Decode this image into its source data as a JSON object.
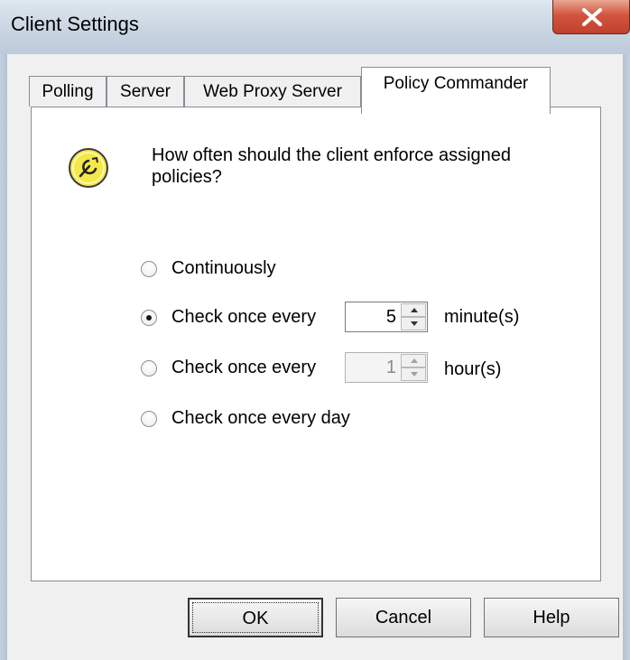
{
  "window": {
    "title": "Client Settings",
    "close_glyph": "X"
  },
  "tabs": [
    {
      "label": "Polling",
      "selected": false
    },
    {
      "label": "Server",
      "selected": false
    },
    {
      "label": "Web Proxy Server",
      "selected": false
    },
    {
      "label": "Policy Commander",
      "selected": true
    }
  ],
  "panel": {
    "icon": "policy-wrench-icon",
    "question": "How often should the client enforce assigned policies?",
    "options": [
      {
        "label": "Continuously",
        "checked": false
      },
      {
        "label": "Check once every",
        "checked": true,
        "value": "5",
        "unit": "minute(s)",
        "enabled": true
      },
      {
        "label": "Check once every",
        "checked": false,
        "value": "1",
        "unit": "hour(s)",
        "enabled": false
      },
      {
        "label": "Check once every day",
        "checked": false
      }
    ]
  },
  "buttons": {
    "ok": "OK",
    "cancel": "Cancel",
    "help": "Help"
  },
  "colors": {
    "icon_fill": "#f2e84a",
    "close_red": "#c9432e",
    "panel": "#ffffff",
    "dialog": "#f0f0f0"
  }
}
